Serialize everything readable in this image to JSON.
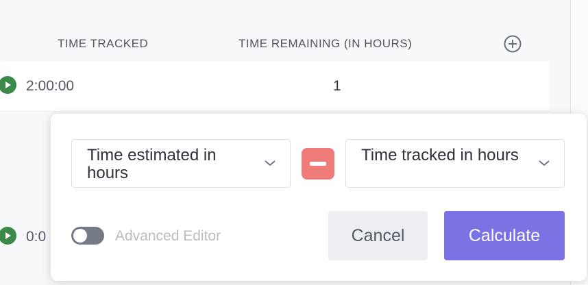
{
  "table": {
    "headers": {
      "time_tracked": "TIME TRACKED",
      "time_remaining": "TIME REMAINING (IN HOURS)"
    },
    "add_column_icon": "plus-circle-icon",
    "rows": [
      {
        "time_tracked": "2:00:00",
        "time_remaining": "1"
      },
      {
        "time_tracked": "0:0",
        "time_remaining": ""
      }
    ]
  },
  "formula_popup": {
    "left_operand": "Time estimated in hours",
    "operator_icon": "minus-icon",
    "right_operand": "Time tracked in hours",
    "advanced_editor_label": "Advanced Editor",
    "advanced_editor_on": false,
    "cancel_label": "Cancel",
    "calculate_label": "Calculate"
  },
  "colors": {
    "play": "#3b8a4a",
    "operator": "#ee7b78",
    "primary": "#7b72e3",
    "toggle_off": "#747b87"
  }
}
